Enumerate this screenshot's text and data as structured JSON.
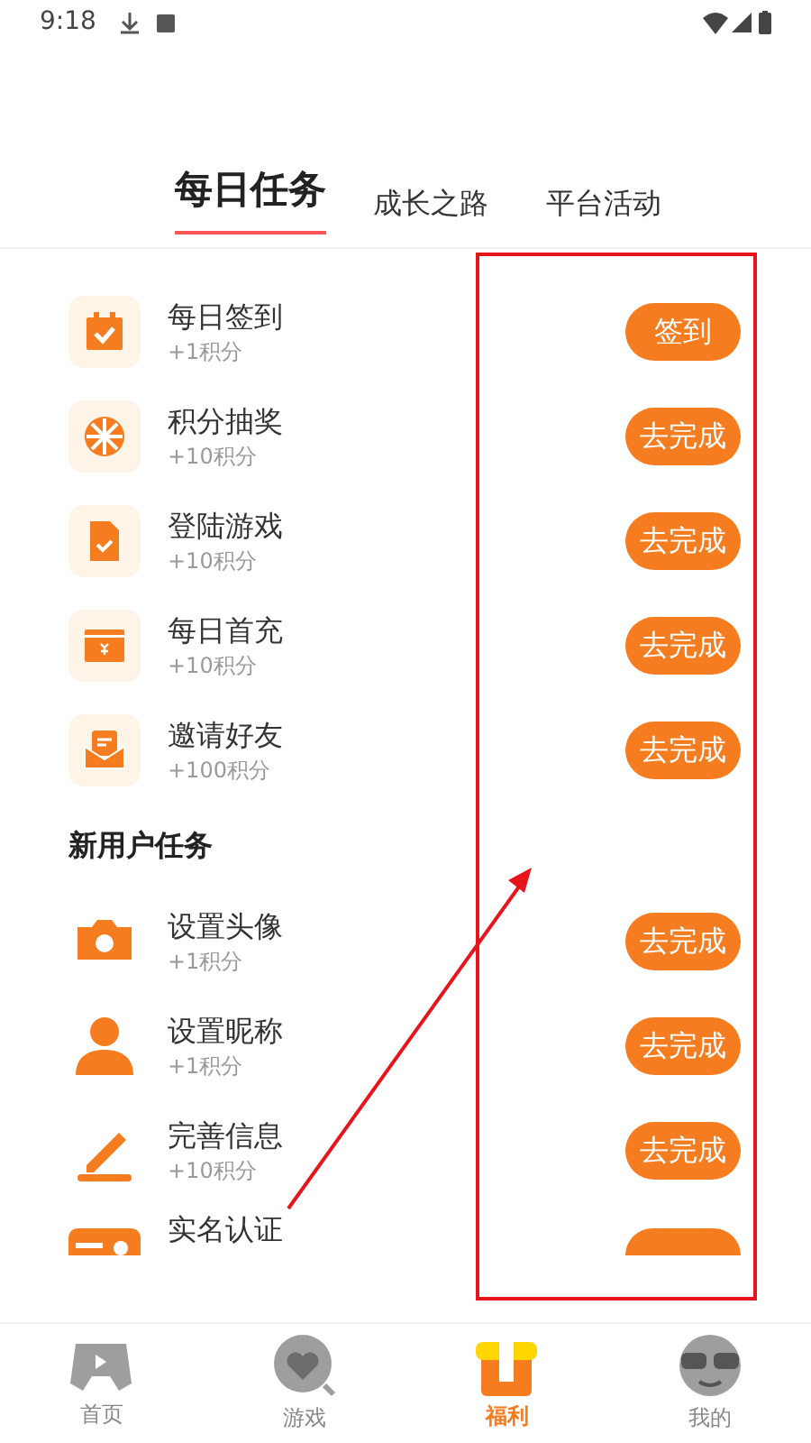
{
  "status_bar": {
    "time": "9:18"
  },
  "tabs": [
    {
      "label": "每日任务",
      "selected": true
    },
    {
      "label": "成长之路",
      "selected": false
    },
    {
      "label": "平台活动",
      "selected": false
    }
  ],
  "sections": [
    {
      "tasks": [
        {
          "title": "每日签到",
          "reward": "+1积分",
          "button": "签到"
        },
        {
          "title": "积分抽奖",
          "reward": "+10积分",
          "button": "去完成"
        },
        {
          "title": "登陆游戏",
          "reward": "+10积分",
          "button": "去完成"
        },
        {
          "title": "每日首充",
          "reward": "+10积分",
          "button": "去完成"
        },
        {
          "title": "邀请好友",
          "reward": "+100积分",
          "button": "去完成"
        }
      ]
    },
    {
      "title": "新用户任务",
      "tasks": [
        {
          "title": "设置头像",
          "reward": "+1积分",
          "button": "去完成"
        },
        {
          "title": "设置昵称",
          "reward": "+1积分",
          "button": "去完成"
        },
        {
          "title": "完善信息",
          "reward": "+10积分",
          "button": "去完成"
        },
        {
          "title": "实名认证"
        }
      ]
    }
  ],
  "bottom_nav": [
    {
      "label": "首页",
      "selected": false
    },
    {
      "label": "游戏",
      "selected": false
    },
    {
      "label": "福利",
      "selected": true
    },
    {
      "label": "我的",
      "selected": false
    }
  ]
}
